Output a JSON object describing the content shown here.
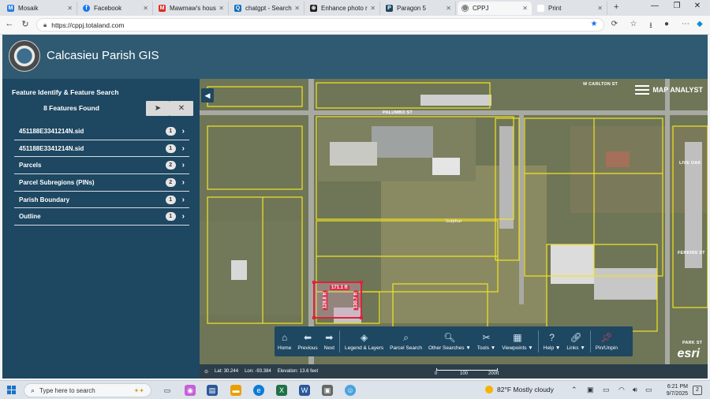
{
  "browser": {
    "tabs": [
      {
        "label": "Mosaik",
        "icon": "mosaik-icon",
        "color": "#2a7de1"
      },
      {
        "label": "Facebook",
        "icon": "facebook-icon",
        "color": "#1877f2"
      },
      {
        "label": "Mawmaw's house",
        "icon": "gmail-icon",
        "color": "#d93025"
      },
      {
        "label": "chatgpt - Search",
        "icon": "search-icon",
        "color": "#0f6cbd"
      },
      {
        "label": "Enhance photo re",
        "icon": "chatgpt-icon",
        "color": "#222222"
      },
      {
        "label": "Paragon 5",
        "icon": "paragon-icon",
        "color": "#1e4761"
      },
      {
        "label": "CPPJ",
        "icon": "globe-icon",
        "color": "#555555"
      },
      {
        "label": "Print",
        "icon": "print-tab-icon",
        "color": "#ffffff"
      }
    ],
    "url": "https://cppj.totaland.com"
  },
  "app": {
    "title": "Calcasieu Parish GIS",
    "header_color": "#2f5a72",
    "panel_color": "#1e4761"
  },
  "panel": {
    "title": "Feature Identify & Feature Search",
    "found": "8 Features Found",
    "features": [
      {
        "label": "451188E3341214N.sid",
        "count": "1"
      },
      {
        "label": "451188E3341214N.sid",
        "count": "1"
      },
      {
        "label": "Parcels",
        "count": "2"
      },
      {
        "label": "Parcel Subregions (PINs)",
        "count": "2"
      },
      {
        "label": "Parish Boundary",
        "count": "1"
      },
      {
        "label": "Outline",
        "count": "1"
      }
    ]
  },
  "map": {
    "brand": "MAP ANALYST",
    "streets": {
      "palumbo": "PALUMBO ST",
      "carlton": "W CARLTON ST",
      "sulphur": "Sulphur",
      "ferkins": "FERKINS ST",
      "live_oak": "LIVE OAK",
      "park": "PARK ST"
    },
    "measurements": [
      "171.1 ft",
      "129.8 ft",
      "130.7 ft"
    ],
    "tools": [
      {
        "label": "Home",
        "icon": "home-icon"
      },
      {
        "label": "Previous",
        "icon": "arrow-left-icon"
      },
      {
        "label": "Next",
        "icon": "arrow-right-icon"
      },
      {
        "label": "Legend & Layers",
        "icon": "layers-icon"
      },
      {
        "label": "Parcel Search",
        "icon": "parcel-search-icon"
      },
      {
        "label": "Other Searches ▼",
        "icon": "search-icon"
      },
      {
        "label": "Tools ▼",
        "icon": "tools-icon"
      },
      {
        "label": "Viewpoints ▼",
        "icon": "viewpoints-icon"
      },
      {
        "label": "Help ▼",
        "icon": "help-icon"
      },
      {
        "label": "Links ▼",
        "icon": "link-icon"
      },
      {
        "label": "Pin/Unpin",
        "icon": "pin-icon"
      }
    ],
    "status": {
      "lat": "Lat: 30.244",
      "lon": "Lon: -93.384",
      "elevation": "Elevation: 13.6 feet"
    },
    "scale": [
      "0",
      "100",
      "200ft"
    ],
    "attribution": "esri"
  },
  "taskbar": {
    "search_placeholder": "Type here to search",
    "weather": "82°F  Mostly cloudy",
    "time": "6:21 PM",
    "date": "9/7/2025",
    "notifications": "2"
  }
}
